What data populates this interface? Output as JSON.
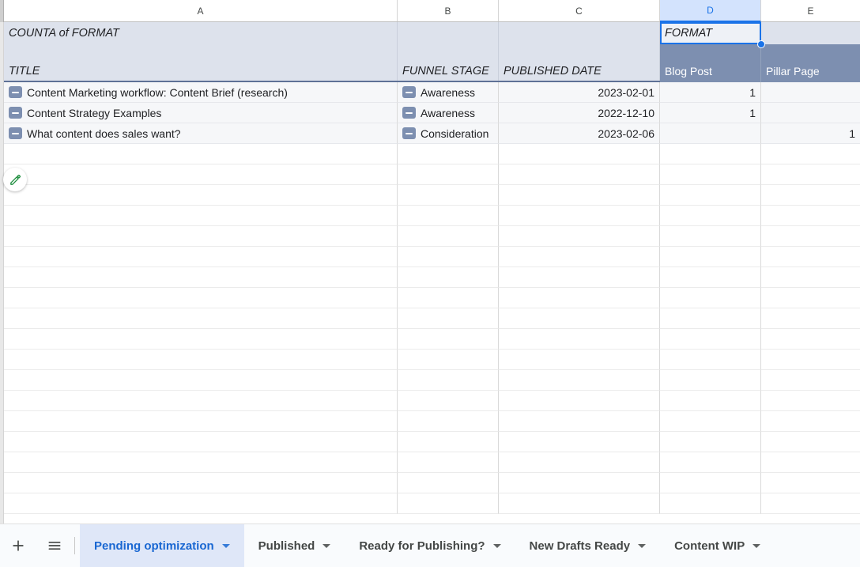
{
  "spreadsheet": {
    "column_headers": [
      "A",
      "B",
      "C",
      "D",
      "E"
    ],
    "selected_column": "D",
    "selected_cell_value": "FORMAT",
    "pivot_title": "COUNTA of FORMAT",
    "row_headers": [
      "TITLE",
      "FUNNEL STAGE",
      "PUBLISHED DATE"
    ],
    "value_headers": [
      "Blog Post",
      "Pillar Page"
    ],
    "rows": [
      {
        "title": "Content Marketing workflow: Content Brief (research)",
        "funnel_stage": "Awareness",
        "published_date": "2023-02-01",
        "blog_post": "1",
        "pillar_page": ""
      },
      {
        "title": "Content Strategy Examples",
        "funnel_stage": "Awareness",
        "published_date": "2022-12-10",
        "blog_post": "1",
        "pillar_page": ""
      },
      {
        "title": "What content does sales want?",
        "funnel_stage": "Consideration",
        "published_date": "2023-02-06",
        "blog_post": "",
        "pillar_page": "1"
      }
    ],
    "colors": {
      "accent": "#1a73e8",
      "pivot_header_bg": "#dde2ec",
      "value_header_bg": "#7d8fb0",
      "active_tab_bg": "#dfe7f8",
      "active_tab_text": "#1967d2",
      "edit_icon": "#1e8e3e"
    }
  },
  "tabbar": {
    "add_sheet_label": "+",
    "all_sheets_label": "All sheets",
    "tabs": [
      {
        "label": "Pending optimization",
        "active": true
      },
      {
        "label": "Published",
        "active": false
      },
      {
        "label": "Ready for Publishing?",
        "active": false
      },
      {
        "label": "New Drafts Ready",
        "active": false
      },
      {
        "label": "Content WIP",
        "active": false
      }
    ]
  }
}
